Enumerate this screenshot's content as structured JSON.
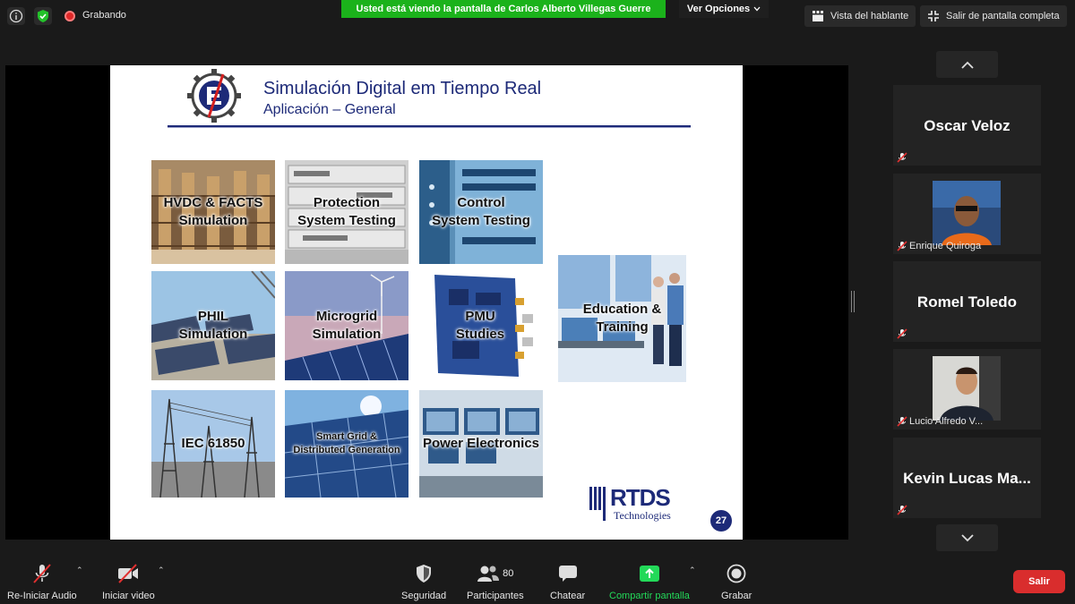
{
  "status": {
    "recording_label": "Grabando",
    "viewing_banner": "Usted está viendo la pantalla de Carlos Alberto Villegas Guerre",
    "view_options": "Ver Opciones",
    "speaker_view": "Vista del hablante",
    "exit_fullscreen": "Salir de pantalla completa"
  },
  "slide": {
    "title": "Simulación Digital em Tiempo Real",
    "subtitle": "Aplicación – General",
    "tiles": [
      {
        "label": "HVDC & FACTS\nSimulation",
        "art": "hvdc"
      },
      {
        "label": "Protection\nSystem Testing",
        "art": "protection"
      },
      {
        "label": "Control\nSystem Testing",
        "art": "control"
      },
      {
        "label": "PHIL\nSimulation",
        "art": "phil"
      },
      {
        "label": "Microgrid\nSimulation",
        "art": "microgrid"
      },
      {
        "label": "PMU\nStudies",
        "art": "pmu"
      },
      {
        "label": "Education &\nTraining",
        "art": "education"
      },
      {
        "label": "IEC 61850",
        "art": "iec"
      },
      {
        "label": "Smart Grid &\nDistributed Generation",
        "art": "smartgrid"
      },
      {
        "label": "Power Electronics",
        "art": "power"
      }
    ],
    "logo_text": "RTDS",
    "logo_sub": "Technologies",
    "page_number": "27"
  },
  "participants": [
    {
      "name": "Oscar Veloz",
      "video": false,
      "muted": true
    },
    {
      "name": "Enrique Quiroga",
      "video": true,
      "muted": true
    },
    {
      "name": "Romel Toledo",
      "video": false,
      "muted": true
    },
    {
      "name": "Lucio Alfredo V...",
      "video": true,
      "muted": true
    },
    {
      "name": "Kevin  Lucas  Ma...",
      "video": false,
      "muted": true
    }
  ],
  "toolbar": {
    "audio": "Re-Iniciar Audio",
    "video": "Iniciar video",
    "security": "Seguridad",
    "participants": "Participantes",
    "participants_count": "80",
    "chat": "Chatear",
    "share": "Compartir pantalla",
    "record": "Grabar",
    "leave": "Salir"
  },
  "colors": {
    "banner_green": "#1bb21b",
    "share_green": "#23d959",
    "leave_red": "#d92d2d",
    "slide_navy": "#1d2a78"
  }
}
